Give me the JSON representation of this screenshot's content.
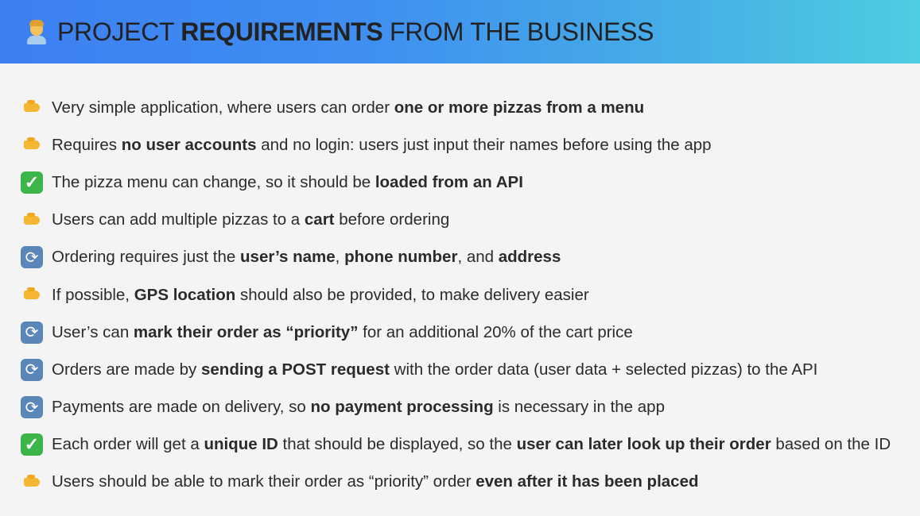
{
  "header": {
    "title_pre": "PROJECT ",
    "title_bold": "REQUIREMENTS",
    "title_post": " FROM THE BUSINESS",
    "icon": "man-office-worker-icon"
  },
  "colors": {
    "check": "#3cb54a",
    "refresh": "#5b86b8",
    "hand": "#f5b731"
  },
  "items": [
    {
      "icon": "hand",
      "parts": [
        {
          "t": "Very simple application, where users can order "
        },
        {
          "t": "one or more pizzas from a menu",
          "b": true
        }
      ]
    },
    {
      "icon": "hand",
      "parts": [
        {
          "t": "Requires "
        },
        {
          "t": "no user accounts",
          "b": true
        },
        {
          "t": " and no login: users just input their names before using the app"
        }
      ]
    },
    {
      "icon": "check",
      "parts": [
        {
          "t": "The pizza menu can change, so it should be "
        },
        {
          "t": "loaded from an API",
          "b": true
        }
      ]
    },
    {
      "icon": "hand",
      "parts": [
        {
          "t": "Users can add multiple pizzas to a "
        },
        {
          "t": "cart",
          "b": true
        },
        {
          "t": " before ordering"
        }
      ]
    },
    {
      "icon": "refresh",
      "parts": [
        {
          "t": "Ordering requires just the "
        },
        {
          "t": "user’s name",
          "b": true
        },
        {
          "t": ", "
        },
        {
          "t": "phone number",
          "b": true
        },
        {
          "t": ", and "
        },
        {
          "t": "address",
          "b": true
        }
      ]
    },
    {
      "icon": "hand",
      "parts": [
        {
          "t": "If possible, "
        },
        {
          "t": "GPS location",
          "b": true
        },
        {
          "t": " should also be provided, to make delivery easier"
        }
      ]
    },
    {
      "icon": "refresh",
      "parts": [
        {
          "t": "User’s can "
        },
        {
          "t": "mark their order as “priority”",
          "b": true
        },
        {
          "t": " for an additional 20% of the cart price"
        }
      ]
    },
    {
      "icon": "refresh",
      "parts": [
        {
          "t": "Orders are made by "
        },
        {
          "t": "sending a POST request",
          "b": true
        },
        {
          "t": " with the order data (user data + selected pizzas) to the API"
        }
      ]
    },
    {
      "icon": "refresh",
      "parts": [
        {
          "t": "Payments are made on delivery, so "
        },
        {
          "t": "no payment processing",
          "b": true
        },
        {
          "t": " is necessary in the app"
        }
      ]
    },
    {
      "icon": "check",
      "parts": [
        {
          "t": "Each order will get a "
        },
        {
          "t": "unique ID",
          "b": true
        },
        {
          "t": " that should be displayed, so the "
        },
        {
          "t": "user can later look up their order",
          "b": true
        },
        {
          "t": " based on the ID"
        }
      ]
    },
    {
      "icon": "hand",
      "parts": [
        {
          "t": "Users should be able to mark their order as “priority” order "
        },
        {
          "t": "even after it has been placed",
          "b": true
        }
      ]
    }
  ]
}
